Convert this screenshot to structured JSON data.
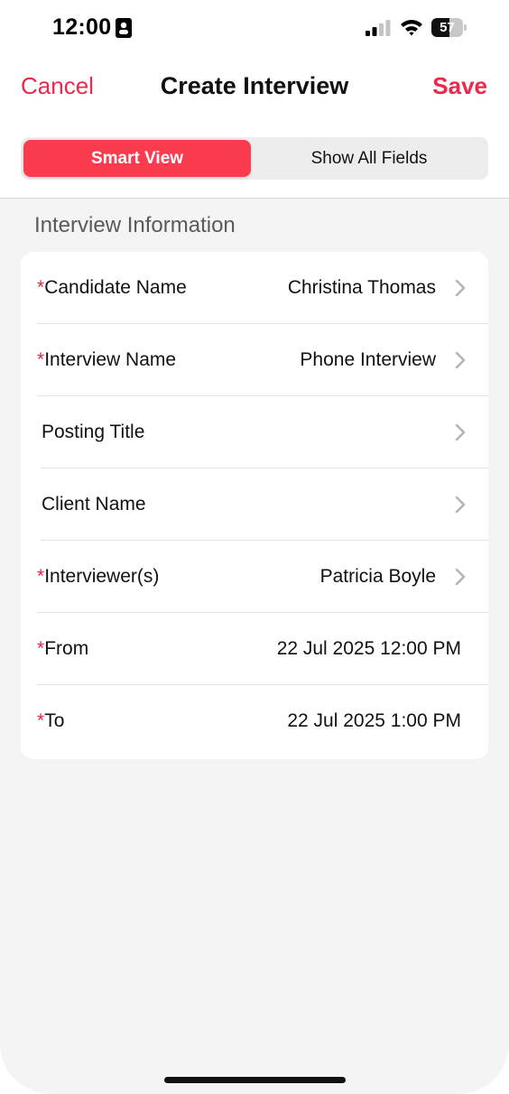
{
  "status_bar": {
    "time": "12:00",
    "battery": "57",
    "battery_level": 0.57
  },
  "nav": {
    "cancel_label": "Cancel",
    "title": "Create Interview",
    "save_label": "Save"
  },
  "segmented": {
    "active_label": "Smart View",
    "inactive_label": "Show All Fields"
  },
  "section": {
    "title": "Interview Information"
  },
  "fields": [
    {
      "label": "Candidate Name",
      "required": "*",
      "value": "Christina Thomas"
    },
    {
      "label": "Interview Name",
      "required": "*",
      "value": "Phone Interview"
    },
    {
      "label": "Posting Title",
      "value": ""
    },
    {
      "label": "Client Name",
      "value": ""
    },
    {
      "label": "Interviewer(s)",
      "required": "*",
      "value": "Patricia Boyle"
    },
    {
      "label": "From",
      "required": "*",
      "value": "22 Jul 2025 12:00 PM"
    },
    {
      "label": "To",
      "required": "*",
      "value": "22 Jul 2025 1:00 PM"
    }
  ],
  "colors": {
    "accent": "#f0264b",
    "segment_active": "#fb3c4e",
    "required": "#e8243c"
  }
}
